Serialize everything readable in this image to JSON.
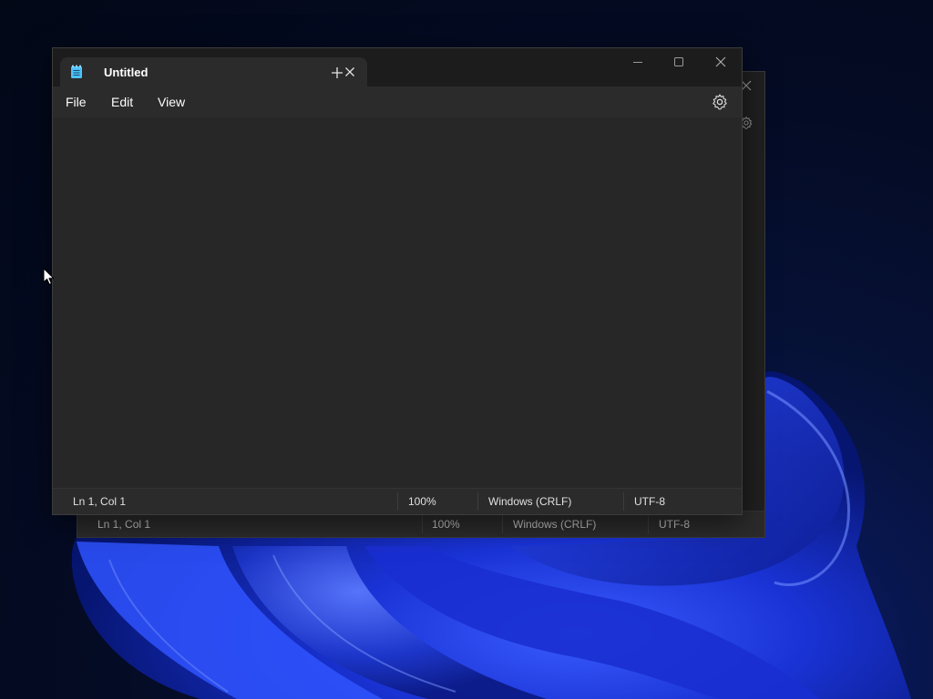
{
  "desktop": {
    "colors": {
      "bg": "#040b24",
      "bloom_primary": "#1f3bff",
      "bloom_dark": "#0a1a8a"
    }
  },
  "back_window": {
    "close_icon": "close-icon",
    "settings_icon": "gear-icon",
    "status": {
      "position": "Ln 1, Col 1",
      "zoom": "100%",
      "line_ending": "Windows (CRLF)",
      "encoding": "UTF-8"
    }
  },
  "front_window": {
    "tab": {
      "icon": "notepad-icon",
      "title": "Untitled",
      "close_icon": "close-icon"
    },
    "new_tab_icon": "plus-icon",
    "controls": {
      "minimize_icon": "minimize-icon",
      "maximize_icon": "maximize-icon",
      "close_icon": "close-icon"
    },
    "menu": {
      "file": "File",
      "edit": "Edit",
      "view": "View",
      "settings_icon": "gear-icon"
    },
    "editor": {
      "text": ""
    },
    "status": {
      "position": "Ln 1, Col 1",
      "zoom": "100%",
      "line_ending": "Windows (CRLF)",
      "encoding": "UTF-8"
    },
    "colors": {
      "titlebar": "#1c1c1c",
      "surface": "#2b2b2b",
      "editor": "#272727",
      "accent": "#4cc2ff",
      "text": "#ffffff"
    }
  }
}
